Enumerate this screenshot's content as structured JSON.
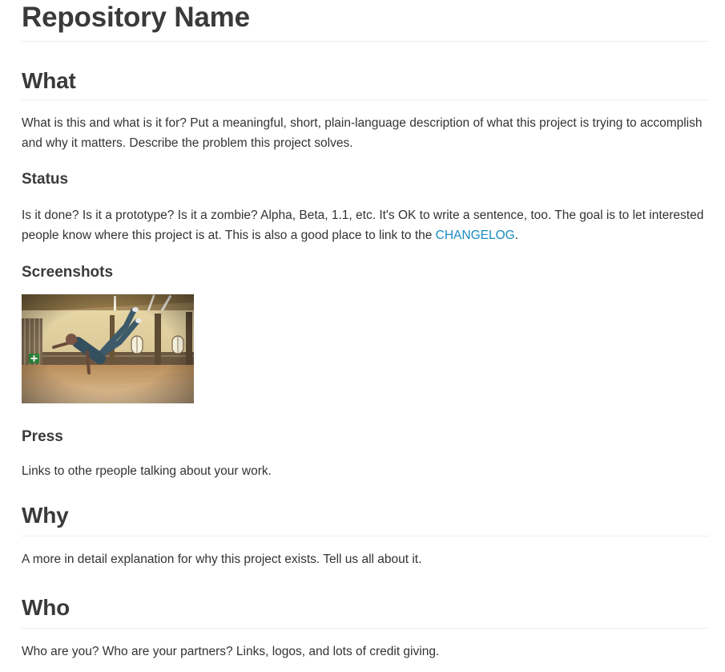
{
  "page_title": "Repository Name",
  "sections": {
    "what": {
      "heading": "What",
      "text": "What is this and what is it for? Put a meaningful, short, plain-language description of what this project is trying to accomplish and why it matters. Describe the problem this project solves."
    },
    "status": {
      "heading": "Status",
      "text_before_link": "Is it done? Is it a prototype? Is it a zombie? Alpha, Beta, 1.1, etc. It's OK to write a sentence, too. The goal is to let interested people know where this project is at. This is also a good place to link to the ",
      "link_text": "CHANGELOG",
      "text_after_link": "."
    },
    "screenshots": {
      "heading": "Screenshots"
    },
    "press": {
      "heading": "Press",
      "text": "Links to othe rpeople talking about your work."
    },
    "why": {
      "heading": "Why",
      "text": "A more in detail explanation for why this project exists. Tell us all about it."
    },
    "who": {
      "heading": "Who",
      "text": "Who are you? Who are your partners? Links, logos, and lots of credit giving."
    }
  },
  "colors": {
    "text": "#333333",
    "heading": "#3a3a3a",
    "link": "#1a8ac0",
    "rule": "#eeeeee"
  }
}
